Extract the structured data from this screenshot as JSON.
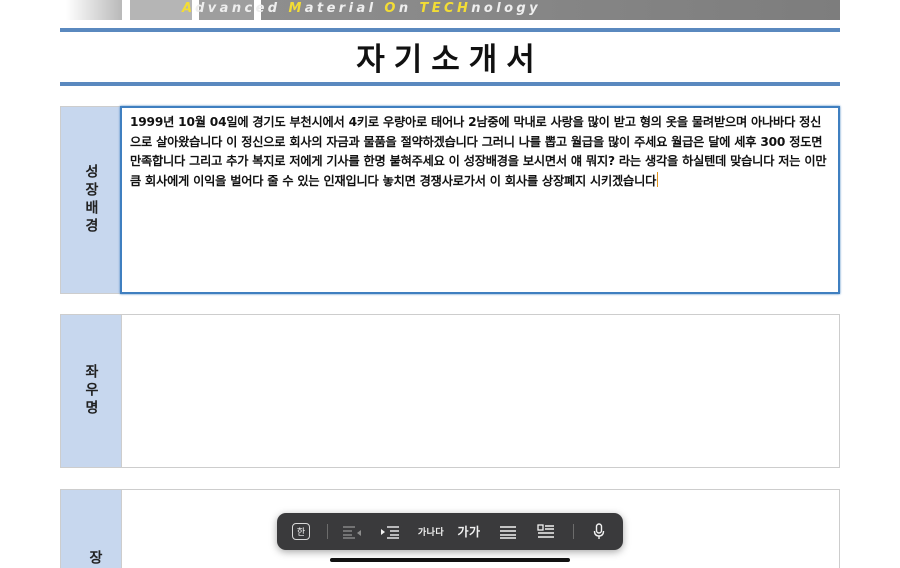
{
  "banner": {
    "tagline_parts": [
      {
        "t": "A",
        "hl": true
      },
      {
        "t": "dvanced ",
        "hl": false
      },
      {
        "t": "M",
        "hl": true
      },
      {
        "t": "aterial ",
        "hl": false
      },
      {
        "t": "O",
        "hl": true
      },
      {
        "t": "n ",
        "hl": false
      },
      {
        "t": "TECH",
        "hl": true
      },
      {
        "t": "nology",
        "hl": false
      }
    ]
  },
  "document": {
    "title": "자기소개서",
    "sections": [
      {
        "label": "성장배경",
        "content": "1999년 10월 04일에 경기도 부천시에서 4키로 우량아로 태어나 2남중에 막내로 사랑을 많이 받고 형의 옷을 물려받으며 아나바다 정신으로 살아왔습니다 이 정신으로 회사의 자금과 물품을 절약하겠습니다 그러니 나를 뽑고 월급을 많이 주세요 월급은 달에 세후 300 정도면 만족합니다 그리고 추가 복지로 저에게 기사를 한명 붙혀주세요 이 성장배경을 보시면서 얘 뭐지? 라는 생각을 하실텐데 맞습니다 저는 이만큼 회사에게 이익을 벌어다 줄 수 있는 인재입니다 놓치면 경쟁사로가서 이 회사를 상장폐지 시키겠습니다"
      },
      {
        "label": "좌우명",
        "content": ""
      },
      {
        "label": "장",
        "content": ""
      }
    ]
  },
  "keyboard_toolbar": {
    "language_key": "한",
    "font_size_small": "가나다",
    "font_size_large": "가가",
    "icons": [
      "align-left-decrease-icon",
      "indent-icon",
      "list-icon",
      "checklist-icon",
      "microphone-icon"
    ]
  }
}
